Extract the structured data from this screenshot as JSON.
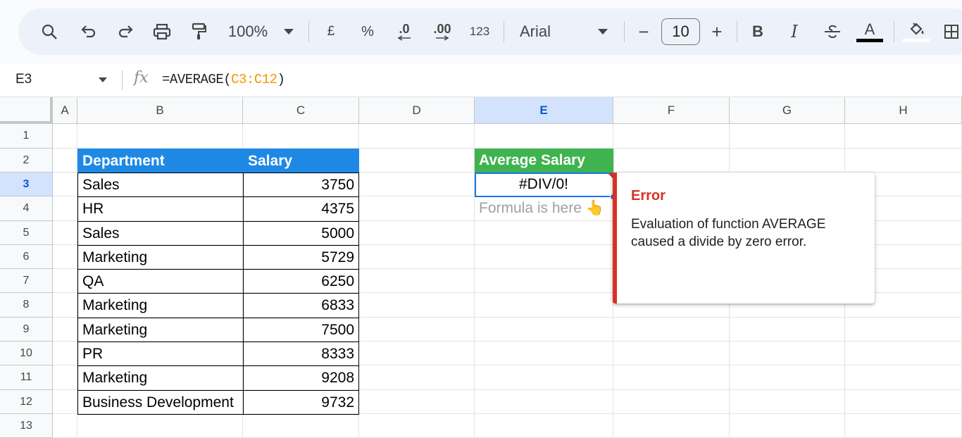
{
  "toolbar": {
    "zoom": "100%",
    "currency": "£",
    "percent": "%",
    "decrease_decimal": ".0",
    "increase_decimal": ".00",
    "more_formats": "123",
    "font": "Arial",
    "font_size": "10",
    "minus": "−",
    "plus": "+",
    "bold": "B",
    "italic": "I",
    "text_color_letter": "A"
  },
  "formula_bar": {
    "cell_ref": "E3",
    "fx": "fx",
    "formula_prefix": "=AVERAGE(",
    "formula_range": "C3:C12",
    "formula_suffix": ")"
  },
  "columns": [
    "A",
    "B",
    "C",
    "D",
    "E",
    "F",
    "G",
    "H"
  ],
  "rows": [
    "1",
    "2",
    "3",
    "4",
    "5",
    "6",
    "7",
    "8",
    "9",
    "10",
    "11",
    "12",
    "13"
  ],
  "table": {
    "headers": [
      "Department",
      "Salary"
    ],
    "rows": [
      [
        "Sales",
        "3750"
      ],
      [
        "HR",
        "4375"
      ],
      [
        "Sales",
        "5000"
      ],
      [
        "Marketing",
        "5729"
      ],
      [
        "QA",
        "6250"
      ],
      [
        "Marketing",
        "6833"
      ],
      [
        "Marketing",
        "7500"
      ],
      [
        "PR",
        "8333"
      ],
      [
        "Marketing",
        "9208"
      ],
      [
        "Business Development",
        "9732"
      ]
    ]
  },
  "avg": {
    "header": "Average Salary",
    "value": "#DIV/0!",
    "note": "Formula is here 👆"
  },
  "error_popup": {
    "title": "Error",
    "message": "Evaluation of function AVERAGE caused a divide by zero error."
  },
  "colors": {
    "header_blue": "#1e88e5",
    "header_green": "#3fb34f",
    "error_red": "#d93025",
    "selection_blue": "#1a73e8"
  }
}
